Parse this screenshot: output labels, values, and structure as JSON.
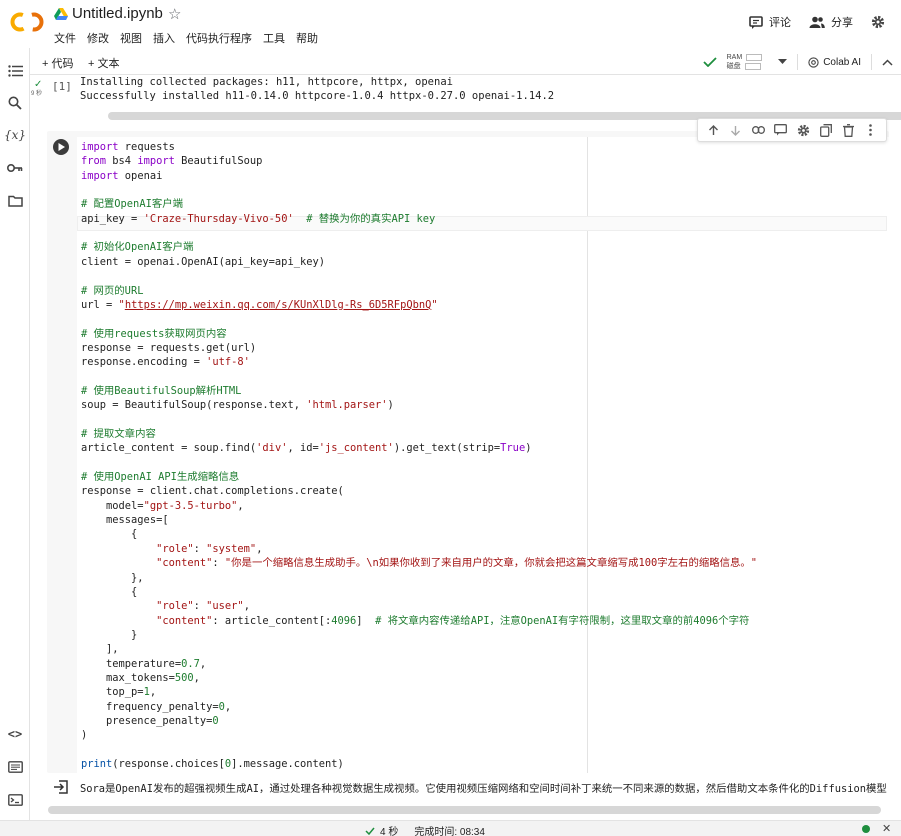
{
  "header": {
    "title": "Untitled.ipynb",
    "menu": [
      "文件",
      "修改",
      "视图",
      "插入",
      "代码执行程序",
      "工具",
      "帮助"
    ],
    "comment_label": "评论",
    "share_label": "分享"
  },
  "toolbar": {
    "add_code": "+ 代码",
    "add_text": "+ 文本",
    "ram_label": "RAM",
    "disk_label": "磁盘",
    "colab_ai": "Colab AI"
  },
  "cell1": {
    "exec_count": "[1]",
    "exec_time": "9 秒",
    "output": [
      "Installing collected packages: h11, httpcore, httpx, openai",
      "Successfully installed h11-0.14.0 httpcore-1.0.4 httpx-0.27.0 openai-1.14.2"
    ]
  },
  "cell2": {
    "code": [
      "import requests",
      "from bs4 import BeautifulSoup",
      "import openai",
      "",
      "# 配置OpenAI客户端",
      "api_key = 'Craze-Thursday-Vivo-50'  # 替换为你的真实API key",
      "",
      "# 初始化OpenAI客户端",
      "client = openai.OpenAI(api_key=api_key)",
      "",
      "# 网页的URL",
      "url = \"https://mp.weixin.qq.com/s/KUnXlDlg-Rs_6D5RFpQbnQ\"",
      "",
      "# 使用requests获取网页内容",
      "response = requests.get(url)",
      "response.encoding = 'utf-8'",
      "",
      "# 使用BeautifulSoup解析HTML",
      "soup = BeautifulSoup(response.text, 'html.parser')",
      "",
      "# 提取文章内容",
      "article_content = soup.find('div', id='js_content').get_text(strip=True)",
      "",
      "# 使用OpenAI API生成缩略信息",
      "response = client.chat.completions.create(",
      "    model=\"gpt-3.5-turbo\",",
      "    messages=[",
      "        {",
      "            \"role\": \"system\",",
      "            \"content\": \"你是一个缩略信息生成助手。\\n如果你收到了来自用户的文章，你就会把这篇文章缩写成100字左右的缩略信息。\"",
      "        },",
      "        {",
      "            \"role\": \"user\",",
      "            \"content\": article_content[:4096]  # 将文章内容传递给API，注意OpenAI有字符限制，这里取文章的前4096个字符",
      "        }",
      "    ],",
      "    temperature=0.7,",
      "    max_tokens=500,",
      "    top_p=1,",
      "    frequency_penalty=0,",
      "    presence_penalty=0",
      ")",
      "",
      "print(response.choices[0].message.content)"
    ],
    "output": "Sora是OpenAI发布的超强视频生成AI，通过处理各种视觉数据生成视频。它使用视频压缩网络和空间时间补丁来统一不同来源的数据，然后借助文本条件化的Diffusion模型"
  },
  "status": {
    "duration": "4 秒",
    "finished": "完成时间: 08:34"
  },
  "colors": {
    "keyword": "#8a00c7",
    "comment": "#1e7c2f",
    "string": "#a31515",
    "builtin": "#0451a5",
    "logo_orange": "#f9ab00",
    "logo_dark_orange": "#e8710a",
    "run_ok": "#1e8e3e"
  }
}
